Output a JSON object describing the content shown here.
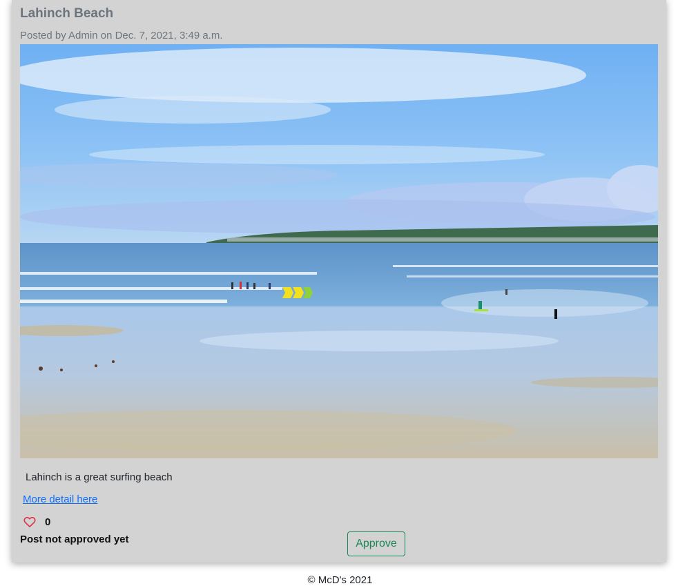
{
  "post": {
    "title": "Lahinch Beach",
    "meta": "Posted by Admin on Dec. 7, 2021, 3:49 a.m.",
    "excerpt": "Lahinch is a great surfing beach",
    "detail_link": "More detail here",
    "like_count": "0",
    "status": "Post not approved yet",
    "approve_label": "Approve",
    "image_alt": "Lahinch beach with surfers"
  },
  "footer": {
    "text": "© McD's 2021"
  },
  "icons": {
    "heart": "heart-outline-icon"
  },
  "colors": {
    "card_background": "#d3d3d3",
    "muted_text": "#6c757d",
    "link": "#0d6efd",
    "approve_green": "#198754",
    "heart_red": "#dc3545"
  }
}
